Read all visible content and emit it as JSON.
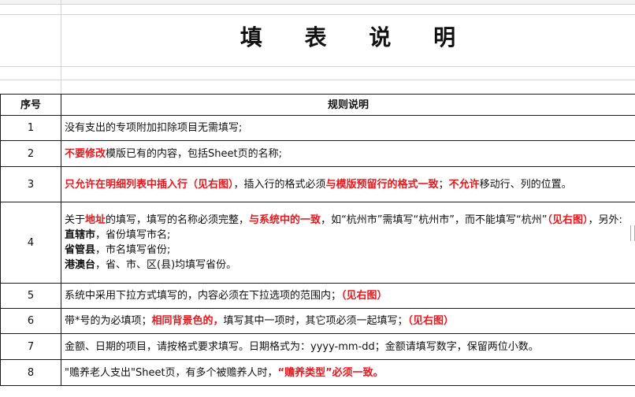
{
  "title": "填 表 说 明",
  "header": {
    "col1": "序号",
    "col2": "规则说明"
  },
  "rows": [
    {
      "num": "1",
      "segments": [
        {
          "t": "没有支出的专项附加扣除项目无需填写;",
          "s": ""
        }
      ]
    },
    {
      "num": "2",
      "segments": [
        {
          "t": "不要修改",
          "s": "red"
        },
        {
          "t": "模版已有的内容，包括Sheet页的名称;",
          "s": ""
        }
      ]
    },
    {
      "num": "3",
      "segments": [
        {
          "t": "只允许在明细列表中插入行（见右图）",
          "s": "red"
        },
        {
          "t": "，插入行的格式必须",
          "s": ""
        },
        {
          "t": "与模版预留行的格式一致",
          "s": "red"
        },
        {
          "t": "；",
          "s": ""
        },
        {
          "t": "不允许",
          "s": "red"
        },
        {
          "t": "移动行、列的位置。",
          "s": ""
        }
      ]
    },
    {
      "num": "4",
      "segments": [
        {
          "t": "关于",
          "s": ""
        },
        {
          "t": "地址",
          "s": "red"
        },
        {
          "t": "的填写，填写的名称必须完整，",
          "s": ""
        },
        {
          "t": "与系统中的一致",
          "s": "red"
        },
        {
          "t": "，如“杭州市”需填写“杭州市”，而不能填写“杭州”",
          "s": ""
        },
        {
          "t": "（见右图）",
          "s": "red"
        },
        {
          "t": "，另外:",
          "s": ""
        },
        {
          "t": "\n",
          "s": "br"
        },
        {
          "t": "直辖市",
          "s": "bold"
        },
        {
          "t": "，省份填写市名;",
          "s": ""
        },
        {
          "t": "\n",
          "s": "br"
        },
        {
          "t": "省管县",
          "s": "bold"
        },
        {
          "t": "，市名填写省份;",
          "s": ""
        },
        {
          "t": "\n",
          "s": "br"
        },
        {
          "t": "港澳台",
          "s": "bold"
        },
        {
          "t": "，省、市、区(县)均填写省份。",
          "s": ""
        }
      ]
    },
    {
      "num": "5",
      "segments": [
        {
          "t": "系统中采用下拉方式填写的，内容必须在下拉选项的范围内；",
          "s": ""
        },
        {
          "t": "（见右图）",
          "s": "red"
        }
      ]
    },
    {
      "num": "6",
      "segments": [
        {
          "t": "带*号的为必填项；",
          "s": ""
        },
        {
          "t": "相同背景色的，",
          "s": "red"
        },
        {
          "t": "填写其中一项时，其它项必须一起填写；",
          "s": ""
        },
        {
          "t": "（见右图）",
          "s": "red"
        }
      ]
    },
    {
      "num": "7",
      "segments": [
        {
          "t": "金额、日期的项目，请按格式要求填写。日期格式为：yyyy-mm-dd；金额请填写数字，保留两位小数。",
          "s": ""
        }
      ]
    },
    {
      "num": "8",
      "segments": [
        {
          "t": "\"赡养老人支出\"Sheet页，有多个被赡养人时，",
          "s": ""
        },
        {
          "t": "“赡养类型”必须一致。",
          "s": "red"
        }
      ]
    }
  ]
}
